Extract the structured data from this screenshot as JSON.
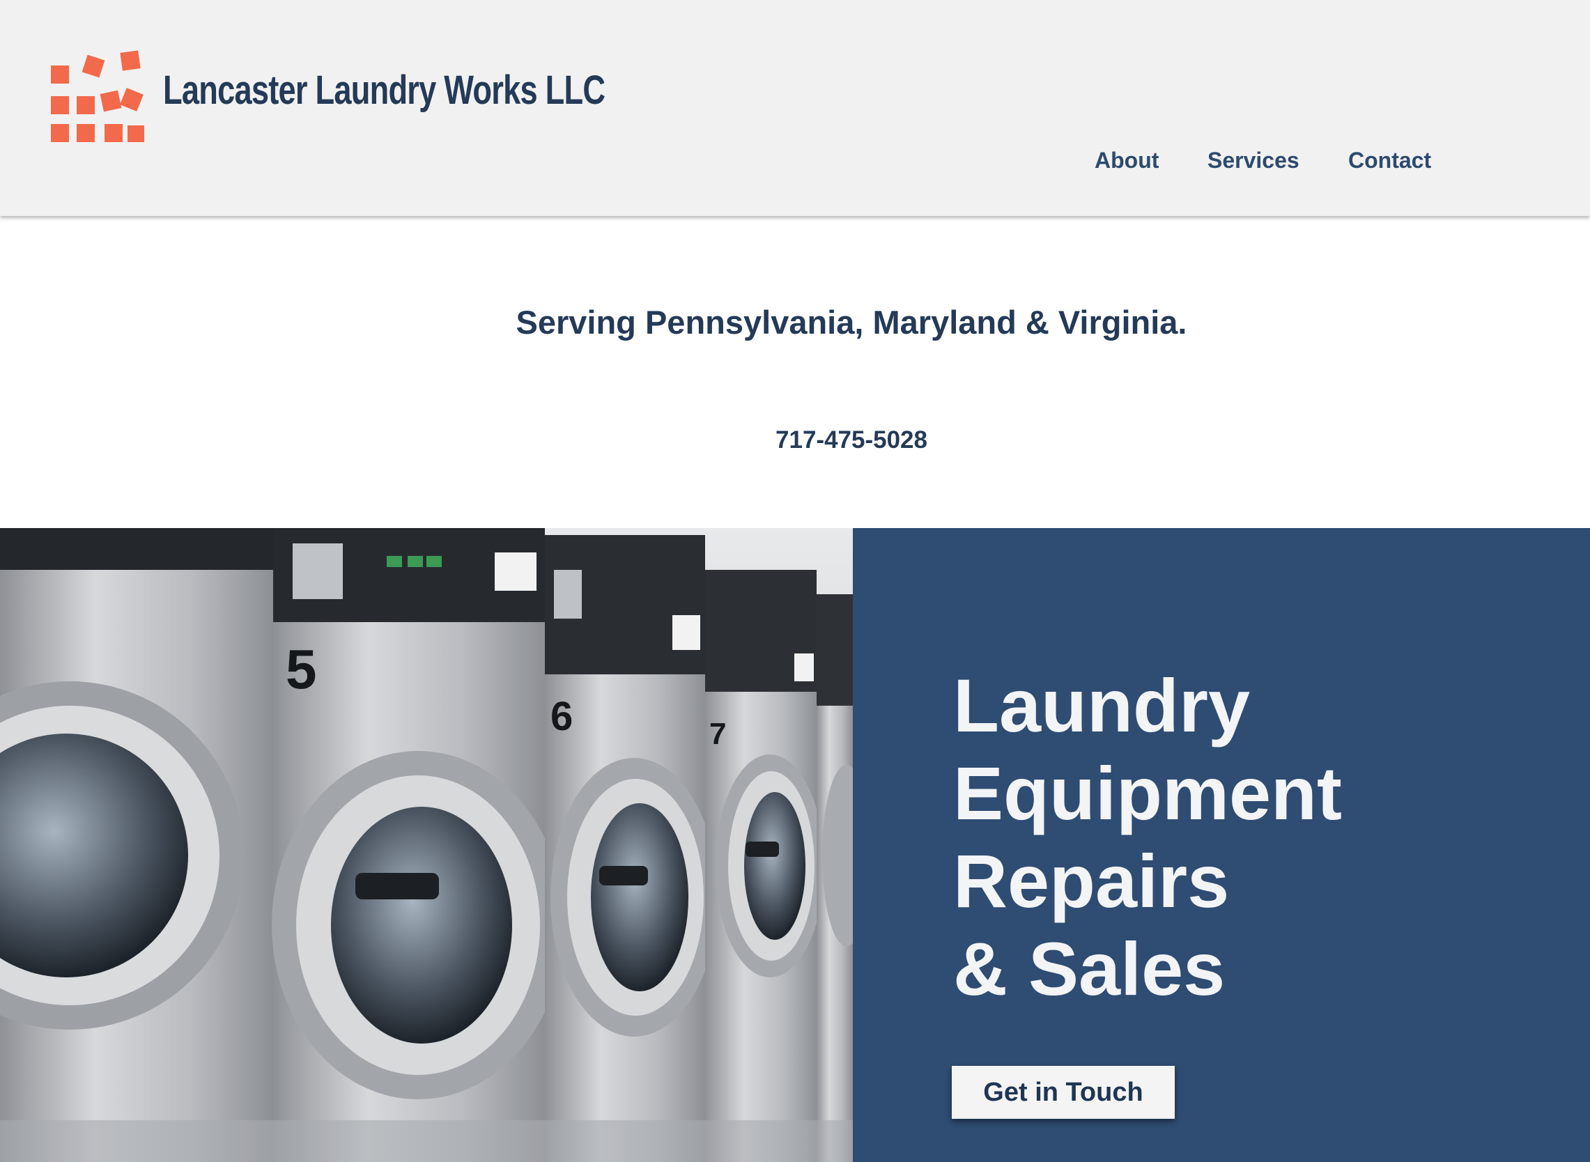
{
  "brand": {
    "name": "Lancaster Laundry Works LLC",
    "logo_icon": "scattered-tiles-logo",
    "logo_color": "#f26a4b",
    "text_color": "#243a57"
  },
  "nav": {
    "items": [
      {
        "label": "About"
      },
      {
        "label": "Services"
      },
      {
        "label": "Contact"
      }
    ]
  },
  "intro": {
    "tagline": "Serving Pennsylvania, Maryland & Virginia.",
    "phone": "717-475-5028"
  },
  "hero": {
    "photo_subject": "row of stainless front-load washing machines",
    "heading_lines": [
      "Laundry",
      "Equipment",
      "Repairs",
      "& Sales"
    ],
    "cta_label": "Get in Touch",
    "panel_color": "#2f4c72"
  },
  "machines": {
    "numbers": [
      "5",
      "6",
      "7"
    ]
  }
}
